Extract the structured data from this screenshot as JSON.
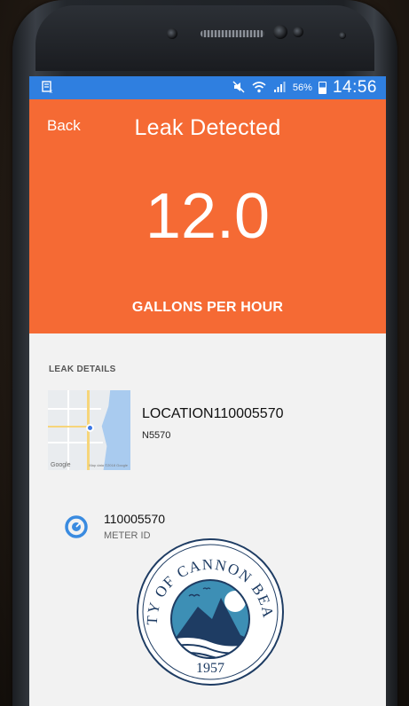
{
  "status_bar": {
    "left_icon": "notification-icon",
    "mute_icon": "mute-icon",
    "wifi_icon": "wifi-icon",
    "signal_icon": "signal-icon",
    "battery_percent": "56%",
    "time": "14:56"
  },
  "header": {
    "back_label": "Back",
    "title": "Leak Detected",
    "value": "12.0",
    "unit": "GALLONS PER HOUR",
    "background_color": "#f56a34"
  },
  "details": {
    "section_label": "LEAK DETAILS",
    "map_brand": "Google",
    "map_credit": "Map data ©2018 Google",
    "location_name": "LOCATION110005570",
    "location_code": "N5570",
    "meter_id_value": "110005570",
    "meter_id_label": "METER ID"
  },
  "seal": {
    "text": "CITY OF CANNON BEACH",
    "year": "1957"
  },
  "colors": {
    "status_bar": "#2f7fe0",
    "accent": "#f56a34",
    "meter_icon": "#3a8be0"
  }
}
